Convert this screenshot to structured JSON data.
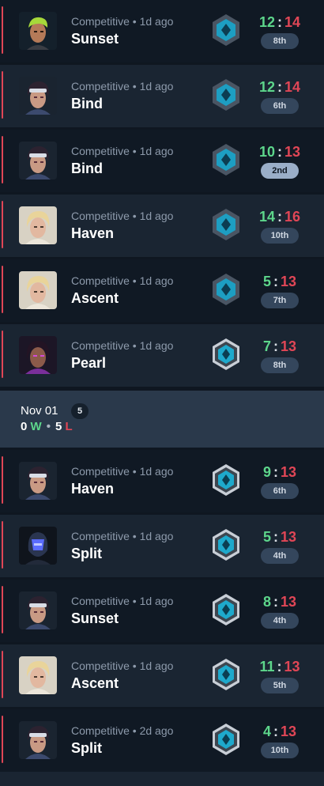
{
  "matches_group1": [
    {
      "mode": "Competitive • 1d ago",
      "map": "Sunset",
      "agent": "agent-green-hair",
      "score_w": "12",
      "score_sep": ":",
      "score_l": "14",
      "place": "8th",
      "place_hi": false,
      "rank": "rank-dark"
    },
    {
      "mode": "Competitive • 1d ago",
      "map": "Bind",
      "agent": "agent-headband",
      "score_w": "12",
      "score_sep": ":",
      "score_l": "14",
      "place": "6th",
      "place_hi": false,
      "rank": "rank-dark"
    },
    {
      "mode": "Competitive • 1d ago",
      "map": "Bind",
      "agent": "agent-headband",
      "score_w": "10",
      "score_sep": ":",
      "score_l": "13",
      "place": "2nd",
      "place_hi": true,
      "rank": "rank-dark"
    },
    {
      "mode": "Competitive • 1d ago",
      "map": "Haven",
      "agent": "agent-blonde",
      "score_w": "14",
      "score_sep": ":",
      "score_l": "16",
      "place": "10th",
      "place_hi": false,
      "rank": "rank-dark"
    },
    {
      "mode": "Competitive • 1d ago",
      "map": "Ascent",
      "agent": "agent-blonde",
      "score_w": "5",
      "score_sep": ":",
      "score_l": "13",
      "place": "7th",
      "place_hi": false,
      "rank": "rank-dark"
    },
    {
      "mode": "Competitive • 1d ago",
      "map": "Pearl",
      "agent": "agent-purple",
      "score_w": "7",
      "score_sep": ":",
      "score_l": "13",
      "place": "8th",
      "place_hi": false,
      "rank": "rank-silver"
    }
  ],
  "day_header": {
    "date": "Nov 01",
    "count": "5",
    "wins": "0",
    "w_label": "W",
    "separator": "•",
    "losses": "5",
    "l_label": "L"
  },
  "matches_group2": [
    {
      "mode": "Competitive • 1d ago",
      "map": "Haven",
      "agent": "agent-headband",
      "score_w": "9",
      "score_sep": ":",
      "score_l": "13",
      "place": "6th",
      "place_hi": false,
      "rank": "rank-silver"
    },
    {
      "mode": "Competitive • 1d ago",
      "map": "Split",
      "agent": "agent-helmet",
      "score_w": "5",
      "score_sep": ":",
      "score_l": "13",
      "place": "4th",
      "place_hi": false,
      "rank": "rank-silver"
    },
    {
      "mode": "Competitive • 1d ago",
      "map": "Sunset",
      "agent": "agent-headband",
      "score_w": "8",
      "score_sep": ":",
      "score_l": "13",
      "place": "4th",
      "place_hi": false,
      "rank": "rank-silver"
    },
    {
      "mode": "Competitive • 1d ago",
      "map": "Ascent",
      "agent": "agent-blonde",
      "score_w": "11",
      "score_sep": ":",
      "score_l": "13",
      "place": "5th",
      "place_hi": false,
      "rank": "rank-silver"
    },
    {
      "mode": "Competitive • 2d ago",
      "map": "Split",
      "agent": "agent-headband",
      "score_w": "4",
      "score_sep": ":",
      "score_l": "13",
      "place": "10th",
      "place_hi": false,
      "rank": "rank-silver"
    }
  ],
  "colors": {
    "win": "#5dd68b",
    "loss": "#e04656",
    "row_dark": "#101924",
    "row_light": "#1a2532",
    "header_bg": "#2a394b"
  }
}
